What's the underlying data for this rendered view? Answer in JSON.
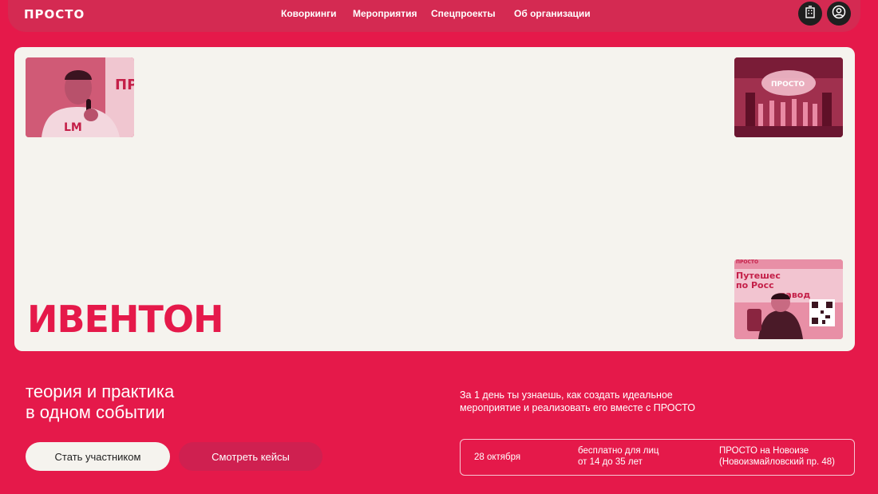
{
  "header": {
    "logo": "ПРОСТО",
    "nav": [
      "Коворкинги",
      "Мероприятия",
      "Спецпроекты",
      "Об организации"
    ],
    "icons": [
      "building-icon",
      "user-icon"
    ]
  },
  "hero": {
    "title": "ИВЕНТОН",
    "photos": [
      "photo-speaker",
      "photo-concert",
      "photo-person-qr"
    ],
    "photo_text": {
      "speaker_shirt": "LM",
      "speaker_banner": "ПР",
      "concert_sign": "ПРОСТО",
      "person_banner_1": "ПРОСТО",
      "person_banner_2": "Путешес",
      "person_banner_3": "по Росс",
      "person_banner_4": "завод"
    }
  },
  "main": {
    "tagline_line1": "теория и практика",
    "tagline_line2": "в одном событии",
    "description_line1": "За 1 день ты узнаешь, как создать идеальное",
    "description_line2": "мероприятие и реализовать его вместе с ПРОСТО",
    "primary_button": "Стать участником",
    "secondary_button": "Смотреть кейсы"
  },
  "info": {
    "date": "28 октября",
    "price_line1": "бесплатно для лиц",
    "price_line2": "от 14 до 35 лет",
    "place_line1": "ПРОСТО на Новоизе",
    "place_line2": "(Новоизмайловский пр. 48)"
  },
  "colors": {
    "background": "#e5194a",
    "header": "#d42a52",
    "card": "#f5f3ee",
    "secondary_button": "#cf2050",
    "icon_button": "#1f1f1f"
  }
}
